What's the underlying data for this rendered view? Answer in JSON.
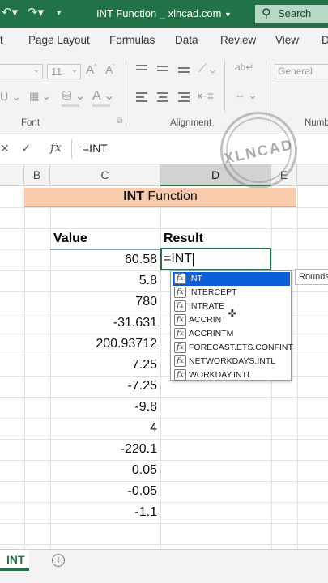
{
  "title_bar": {
    "title": "INT Function _ xlncad.com",
    "search_label": "Search",
    "undo_icon": "undo-icon",
    "redo_icon": "redo-icon",
    "dropdown_icon": "chevron-down-icon",
    "accent": "#217346"
  },
  "menu": {
    "tabs": [
      "t",
      "Page Layout",
      "Formulas",
      "Data",
      "Review",
      "View",
      "D"
    ]
  },
  "ribbon": {
    "font_size": "11",
    "number_format": "General",
    "font_group_label": "Font",
    "alignment_group_label": "Alignment",
    "number_group_label": "Numb"
  },
  "formula_bar": {
    "content": "=INT",
    "fx_label": "fx"
  },
  "columns": [
    "B",
    "C",
    "D",
    "E"
  ],
  "sheet": {
    "banner_bold": "INT",
    "banner_rest": " Function",
    "banner_color": "#f8cbad",
    "header_value": "Value",
    "header_result": "Result",
    "values": [
      "60.58",
      "5.8",
      "780",
      "-31.631",
      "200.93712",
      "7.25",
      "-7.25",
      "-9.8",
      "4",
      "-220.1",
      "0.05",
      "-0.05",
      "-1.1"
    ],
    "active_cell_text": "=INT"
  },
  "autocomplete": {
    "items": [
      "INT",
      "INTERCEPT",
      "INTRATE",
      "ACCRINT",
      "ACCRINTM",
      "FORECAST.ETS.CONFINT",
      "NETWORKDAYS.INTL",
      "WORKDAY.INTL"
    ],
    "selected_index": 0,
    "selected_color": "#0a5fd8",
    "tooltip": "Rounds"
  },
  "watermark": {
    "text": "XLNCAD"
  },
  "sheet_tabs": {
    "active": "INT",
    "add_icon": "plus-circle-icon"
  }
}
